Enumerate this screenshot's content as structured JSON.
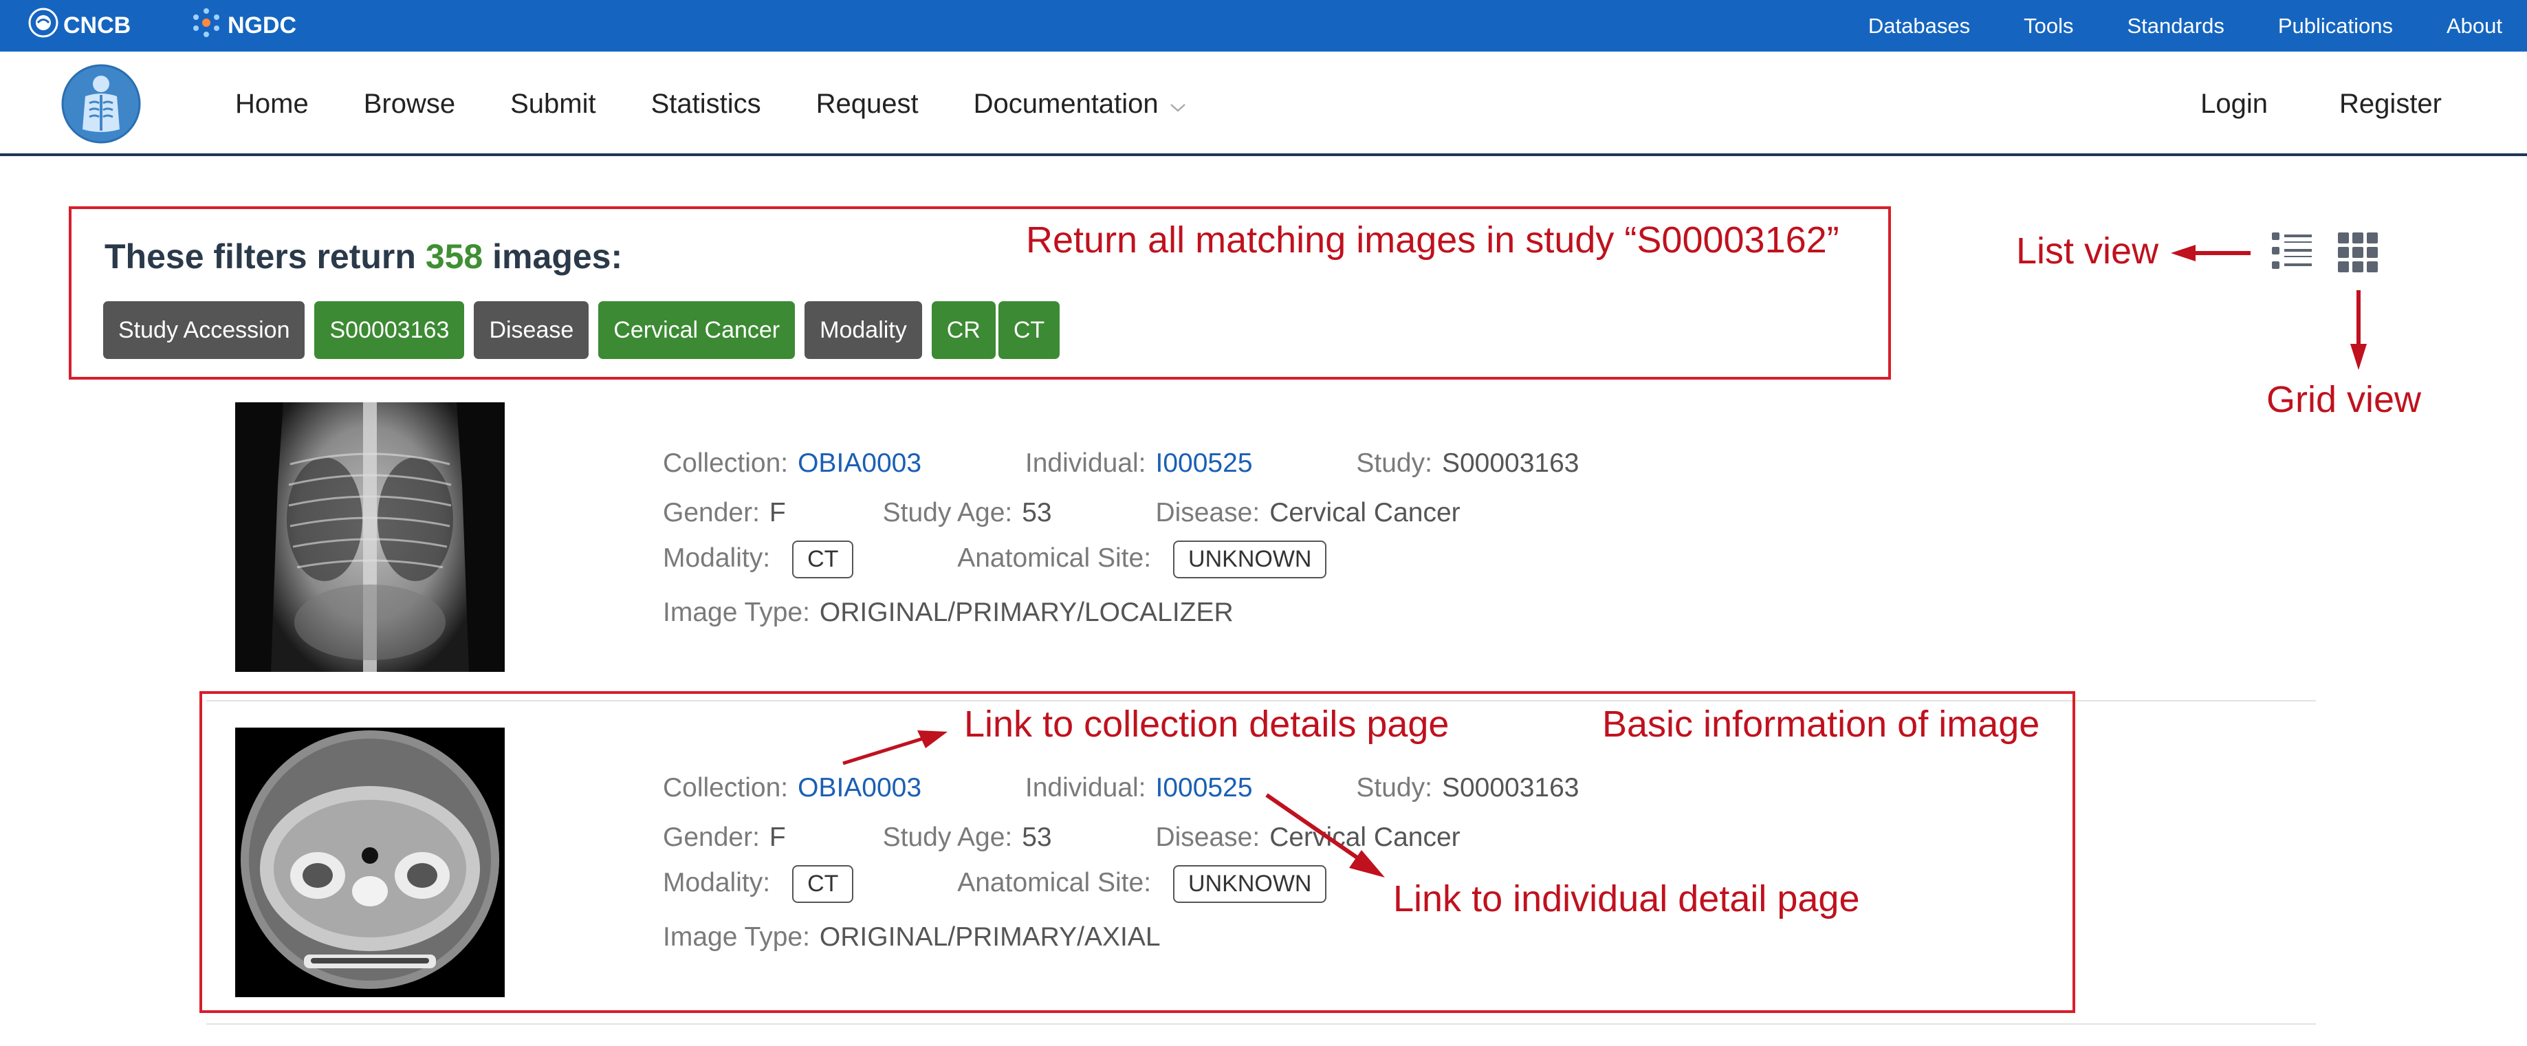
{
  "topbar": {
    "brand_left": "CNCB",
    "brand_right": "NGDC",
    "links": [
      "Databases",
      "Tools",
      "Standards",
      "Publications",
      "About"
    ]
  },
  "nav": {
    "items": [
      "Home",
      "Browse",
      "Submit",
      "Statistics",
      "Request",
      "Documentation"
    ],
    "right": [
      "Login",
      "Register"
    ]
  },
  "filters": {
    "title_pre": "These filters return",
    "count": "358",
    "title_post": "images:",
    "tags": [
      {
        "text": "Study Accession",
        "kind": "key"
      },
      {
        "text": "S00003163",
        "kind": "val"
      },
      {
        "text": "Disease",
        "kind": "key"
      },
      {
        "text": "Cervical Cancer",
        "kind": "val"
      },
      {
        "text": "Modality",
        "kind": "key"
      },
      {
        "text": "CR",
        "kind": "val"
      },
      {
        "text": "CT",
        "kind": "val"
      }
    ]
  },
  "annotations": {
    "study_note": "Return all matching images in study “S00003162”",
    "list_view": "List view",
    "grid_view": "Grid view",
    "collection_link": "Link to collection details page",
    "basic_info": "Basic information of image",
    "individual_link": "Link to individual detail page"
  },
  "labels": {
    "collection": "Collection:",
    "individual": "Individual:",
    "study": "Study:",
    "gender": "Gender:",
    "study_age": "Study Age:",
    "disease": "Disease:",
    "modality": "Modality:",
    "anatomical_site": "Anatomical Site:",
    "image_type": "Image Type:"
  },
  "images": [
    {
      "collection": "OBIA0003",
      "individual": "I000525",
      "study": "S00003163",
      "gender": "F",
      "study_age": "53",
      "disease": "Cervical Cancer",
      "modality": "CT",
      "anatomical_site": "UNKNOWN",
      "image_type": "ORIGINAL/PRIMARY/LOCALIZER"
    },
    {
      "collection": "OBIA0003",
      "individual": "I000525",
      "study": "S00003163",
      "gender": "F",
      "study_age": "53",
      "disease": "Cervical Cancer",
      "modality": "CT",
      "anatomical_site": "UNKNOWN",
      "image_type": "ORIGINAL/PRIMARY/AXIAL"
    }
  ],
  "colors": {
    "topbar": "#1565c0",
    "annotation_red": "#c0111e",
    "tag_green": "#3c8a33",
    "tag_gray": "#555555",
    "link_blue": "#1a5fb4"
  },
  "icons": {
    "brand_left": "cncb-globe-icon",
    "brand_right": "ngdc-network-icon",
    "logo": "chest-xray-logo-icon",
    "dropdown": "chevron-down-icon",
    "list_view": "list-view-icon",
    "grid_view": "grid-view-icon"
  }
}
